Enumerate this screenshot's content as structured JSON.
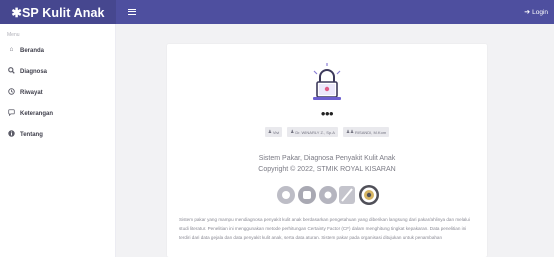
{
  "navbar": {
    "brand": "✱SP Kulit Anak",
    "login_label": "Login",
    "accent_color": "#4e4f9f"
  },
  "sidebar": {
    "heading": "Menu",
    "items": [
      {
        "label": "Beranda",
        "icon": "home-icon"
      },
      {
        "label": "Diagnosa",
        "icon": "search-icon"
      },
      {
        "label": "Riwayat",
        "icon": "history-icon"
      },
      {
        "label": "Keterangan",
        "icon": "comment-icon"
      },
      {
        "label": "Tentang",
        "icon": "info-icon"
      }
    ]
  },
  "main": {
    "ellipsis": "•••",
    "developers": [
      "Vivi",
      "Dr. WINARLY Z., Sp.A",
      "RISANDI, M.Kom"
    ],
    "app_title": "Sistem Pakar, Diagnosa Penyakit Kulit Anak",
    "copyright": "Copyright © 2022, STMIK ROYAL KISARAN",
    "description": "Sistem pakar yang mampu mendiagnosa penyakit kulit anak berdasarkan pengetahuan yang diberikan langsung dari pakar/ahlinya dan melalui studi literatur. Penelitian ini menggunakan metode perhitungan Certainty Factor (CF) dalam menghitung tingkat kepakaran. Data penelitian ini terdiri dari data gejala dan data penyakit kulit anak, serta data aturan. Sistem pakar pada organisasi ditujukan untuk penambahan"
  }
}
